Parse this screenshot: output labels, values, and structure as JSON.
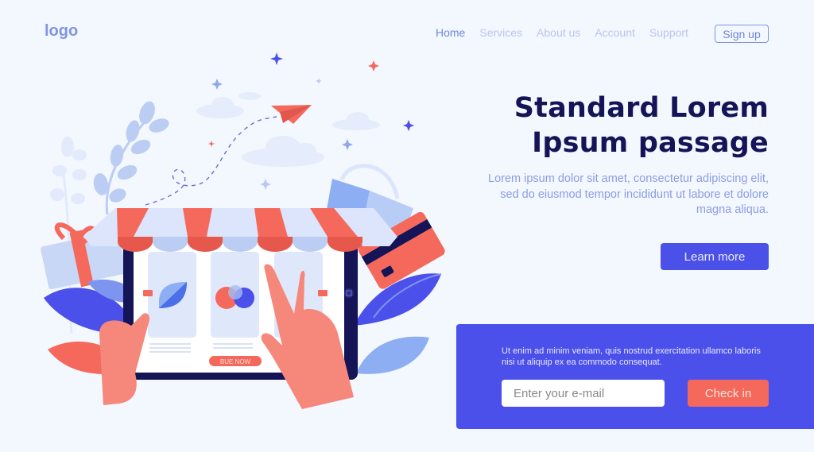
{
  "header": {
    "logo": "logo",
    "nav": [
      {
        "label": "Home",
        "active": true
      },
      {
        "label": "Services",
        "active": false
      },
      {
        "label": "About us",
        "active": false
      },
      {
        "label": "Account",
        "active": false
      },
      {
        "label": "Support",
        "active": false
      }
    ],
    "signup_label": "Sign up"
  },
  "hero": {
    "title_line1": "Standard Lorem",
    "title_line2": "Ipsum passage",
    "subtitle": "Lorem ipsum dolor sit amet, consectetur adipiscing elit, sed do eiusmod tempor incididunt ut labore et dolore magna aliqua.",
    "cta_label": "Learn more"
  },
  "subscribe": {
    "text": "Ut enim ad minim veniam, quis nostrud exercitation ullamco laboris nisi ut aliquip ex ea commodo consequat.",
    "email_placeholder": "Enter your e-mail",
    "email_value": "",
    "submit_label": "Check in"
  },
  "illustration": {
    "buy_button_label": "BUE NOW",
    "icons": [
      "paper-plane-icon",
      "leaf-icon",
      "apples-icon",
      "shopping-bag-icon",
      "credit-card-icon",
      "gift-icon",
      "sparkle-icon",
      "cloud-icon"
    ]
  },
  "colors": {
    "background": "#f3f7fe",
    "primary": "#4c50ea",
    "accent": "#f4695c",
    "heading": "#141457",
    "muted": "#8c9de6"
  }
}
